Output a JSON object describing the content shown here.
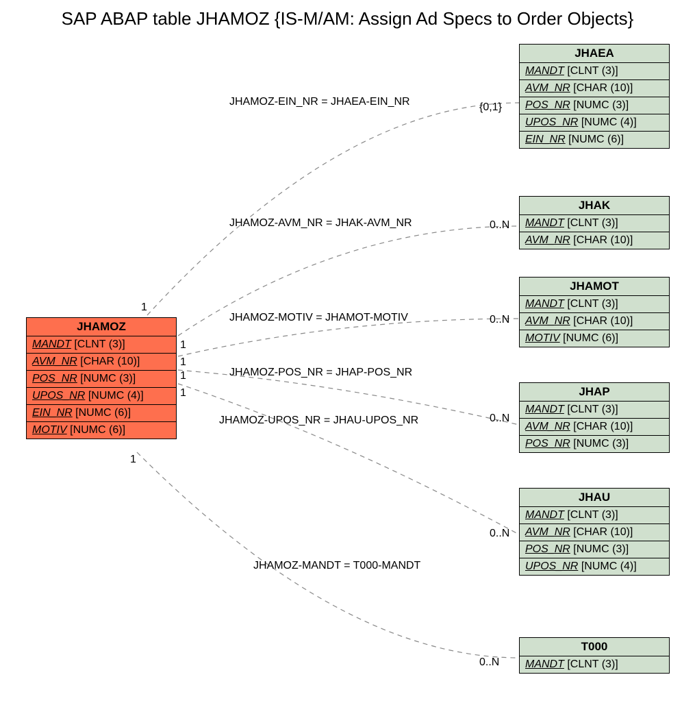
{
  "title": "SAP ABAP table JHAMOZ {IS-M/AM: Assign Ad Specs to Order Objects}",
  "main": {
    "name": "JHAMOZ",
    "fields": [
      {
        "key": "MANDT",
        "type": "[CLNT (3)]"
      },
      {
        "key": "AVM_NR",
        "type": "[CHAR (10)]"
      },
      {
        "key": "POS_NR",
        "type": "[NUMC (3)]"
      },
      {
        "key": "UPOS_NR",
        "type": "[NUMC (4)]"
      },
      {
        "key": "EIN_NR",
        "type": "[NUMC (6)]"
      },
      {
        "key": "MOTIV",
        "type": "[NUMC (6)]"
      }
    ]
  },
  "related": {
    "jhaea": {
      "name": "JHAEA",
      "fields": [
        {
          "key": "MANDT",
          "type": "[CLNT (3)]"
        },
        {
          "key": "AVM_NR",
          "type": "[CHAR (10)]"
        },
        {
          "key": "POS_NR",
          "type": "[NUMC (3)]"
        },
        {
          "key": "UPOS_NR",
          "type": "[NUMC (4)]"
        },
        {
          "key": "EIN_NR",
          "type": "[NUMC (6)]"
        }
      ]
    },
    "jhak": {
      "name": "JHAK",
      "fields": [
        {
          "key": "MANDT",
          "type": "[CLNT (3)]"
        },
        {
          "key": "AVM_NR",
          "type": "[CHAR (10)]"
        }
      ]
    },
    "jhamot": {
      "name": "JHAMOT",
      "fields": [
        {
          "key": "MANDT",
          "type": "[CLNT (3)]"
        },
        {
          "key": "AVM_NR",
          "type": "[CHAR (10)]"
        },
        {
          "key": "MOTIV",
          "type": "[NUMC (6)]"
        }
      ]
    },
    "jhap": {
      "name": "JHAP",
      "fields": [
        {
          "key": "MANDT",
          "type": "[CLNT (3)]"
        },
        {
          "key": "AVM_NR",
          "type": "[CHAR (10)]"
        },
        {
          "key": "POS_NR",
          "type": "[NUMC (3)]"
        }
      ]
    },
    "jhau": {
      "name": "JHAU",
      "fields": [
        {
          "key": "MANDT",
          "type": "[CLNT (3)]"
        },
        {
          "key": "AVM_NR",
          "type": "[CHAR (10)]"
        },
        {
          "key": "POS_NR",
          "type": "[NUMC (3)]"
        },
        {
          "key": "UPOS_NR",
          "type": "[NUMC (4)]"
        }
      ]
    },
    "t000": {
      "name": "T000",
      "fields": [
        {
          "key": "MANDT",
          "type": "[CLNT (3)]"
        }
      ]
    }
  },
  "relations": {
    "r1": {
      "label": "JHAMOZ-EIN_NR = JHAEA-EIN_NR",
      "left": "1",
      "right": "{0,1}"
    },
    "r2": {
      "label": "JHAMOZ-AVM_NR = JHAK-AVM_NR",
      "left": "1",
      "right": "0..N"
    },
    "r3": {
      "label": "JHAMOZ-MOTIV = JHAMOT-MOTIV",
      "left": "1",
      "right": "0..N"
    },
    "r4": {
      "label": "JHAMOZ-POS_NR = JHAP-POS_NR",
      "left": "1",
      "right": ""
    },
    "r5": {
      "label": "JHAMOZ-UPOS_NR = JHAU-UPOS_NR",
      "left": "1",
      "right": "0..N"
    },
    "r6": {
      "label": "JHAMOZ-MANDT = T000-MANDT",
      "left": "1",
      "right": "0..N"
    }
  }
}
